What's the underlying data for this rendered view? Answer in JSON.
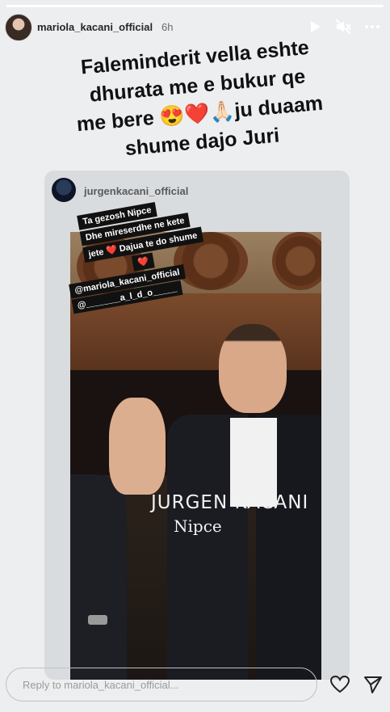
{
  "story": {
    "progress": 1.0,
    "username": "mariola_kacani_official",
    "time": "6h",
    "icons": [
      "play-icon",
      "mute-icon",
      "more-icon"
    ]
  },
  "caption": {
    "lines": [
      "Faleminderit vella eshte",
      "dhurata me e bukur qe",
      "me bere 😍❤️🙏🏻ju duaam",
      "shume dajo Juri"
    ]
  },
  "shared_post": {
    "username": "jurgenkacani_official",
    "sticker_lines": [
      "Ta gezosh Nipce",
      "Dhe mireserdhe ne kete",
      "jete ❤️ Dajua te do shume",
      "❤️"
    ],
    "mentions": [
      "@mariola_kacani_official",
      "@_______a_l_d_o_____"
    ],
    "video_title": "JURGEN KACANI",
    "video_subtitle": "Nipce"
  },
  "reply": {
    "placeholder": "Reply to mariola_kacani_official...",
    "icons": [
      "heart-icon",
      "send-icon"
    ]
  },
  "colors": {
    "background": "#eceef0",
    "card": "#d9dcdf",
    "sticker": "#111111"
  }
}
